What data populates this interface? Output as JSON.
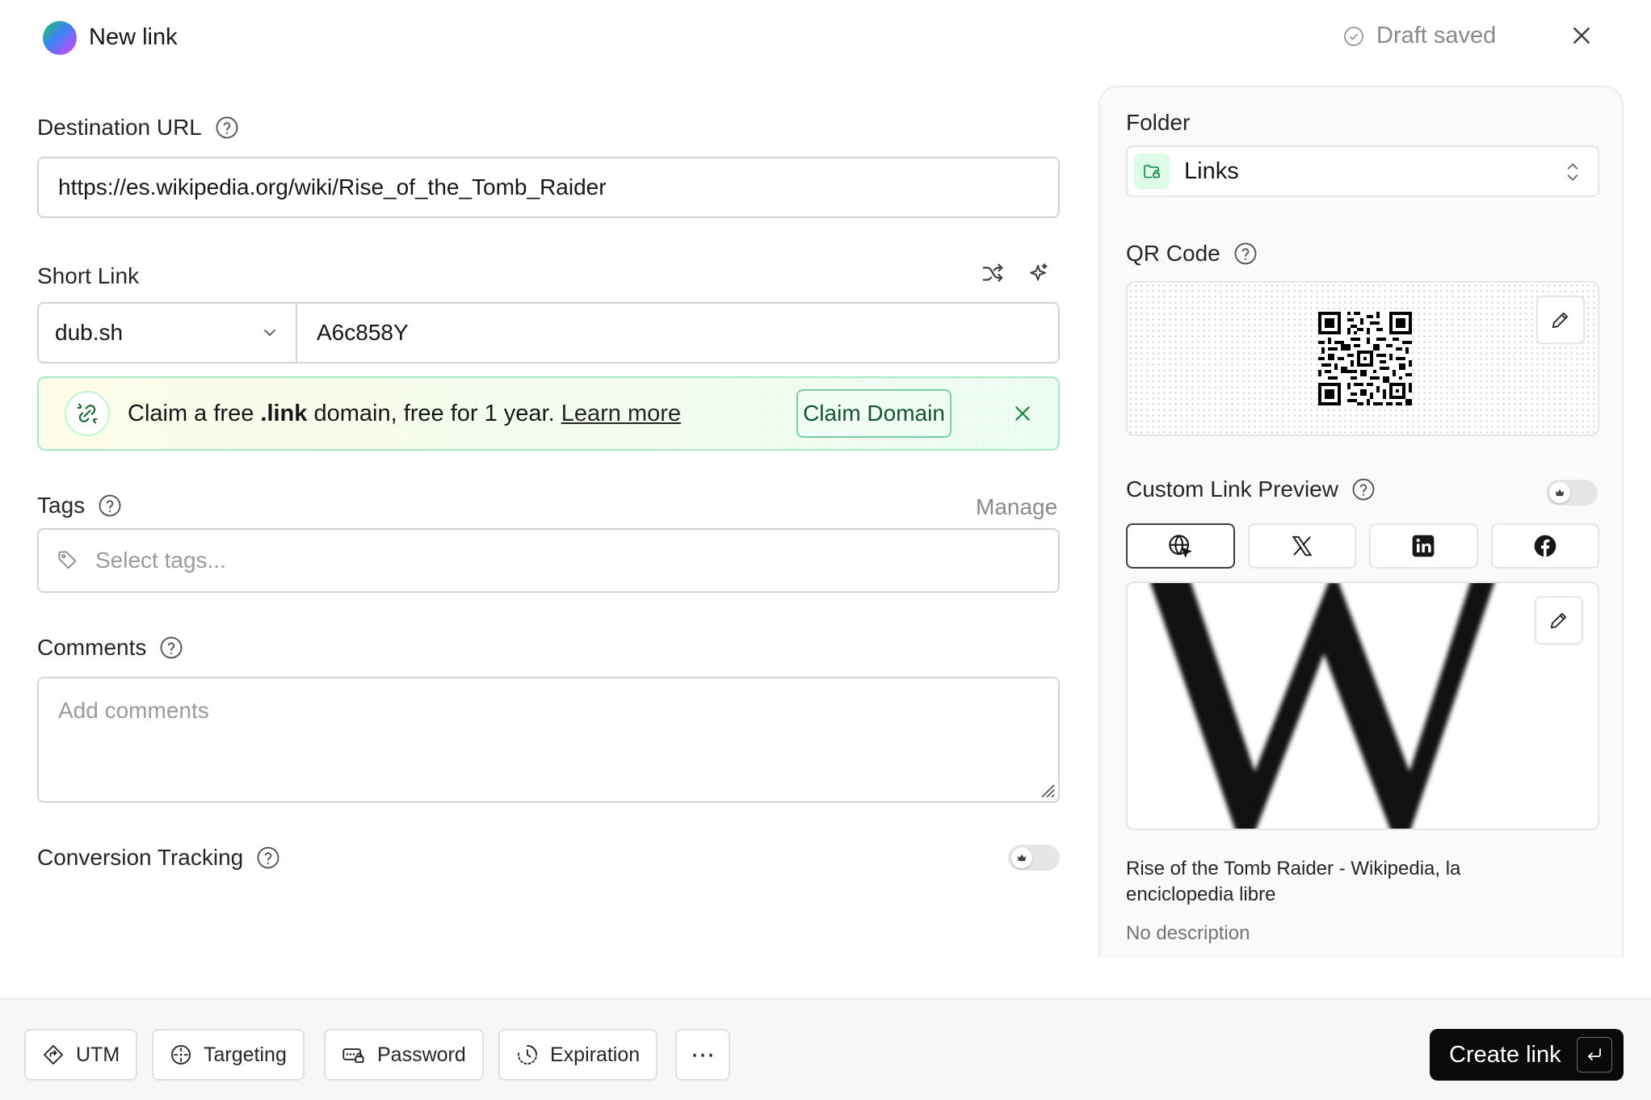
{
  "header": {
    "title": "New link",
    "status": "Draft saved"
  },
  "destination": {
    "label": "Destination URL",
    "value": "https://es.wikipedia.org/wiki/Rise_of_the_Tomb_Raider"
  },
  "short_link": {
    "label": "Short Link",
    "domain": "dub.sh",
    "key": "A6c858Y"
  },
  "banner": {
    "text_before": "Claim a free ",
    "text_bold": ".link",
    "text_after": " domain, free for 1 year. ",
    "link": "Learn more",
    "button": "Claim Domain"
  },
  "tags": {
    "label": "Tags",
    "manage": "Manage",
    "placeholder": "Select tags..."
  },
  "comments": {
    "label": "Comments",
    "placeholder": "Add comments"
  },
  "conversion": {
    "label": "Conversion Tracking",
    "enabled": false
  },
  "folder": {
    "label": "Folder",
    "value": "Links"
  },
  "qr": {
    "label": "QR Code"
  },
  "preview": {
    "label": "Custom Link Preview",
    "enabled": false,
    "tabs": [
      "globe-icon",
      "x-icon",
      "linkedin-icon",
      "facebook-icon"
    ],
    "title": "Rise of the Tomb Raider - Wikipedia, la enciclopedia libre",
    "description": "No description"
  },
  "footer": {
    "buttons": [
      "UTM",
      "Targeting",
      "Password",
      "Expiration"
    ],
    "more": "⋯",
    "create": "Create link"
  }
}
